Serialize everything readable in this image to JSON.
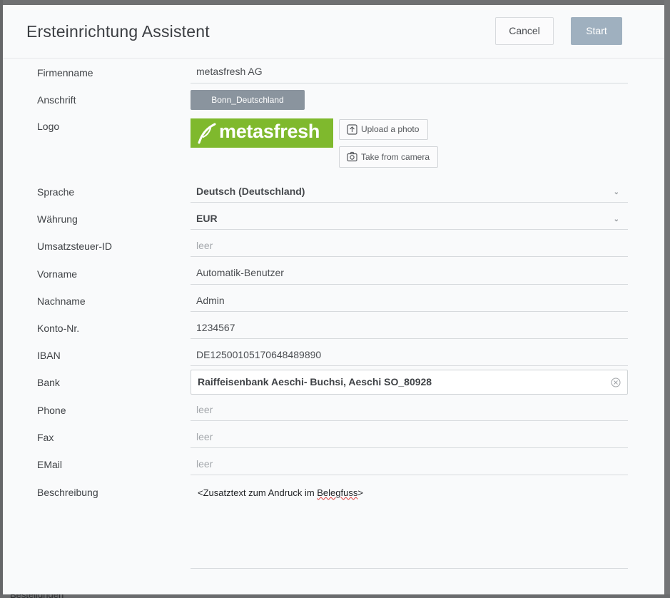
{
  "dialog": {
    "title": "Ersteinrichtung Assistent",
    "cancel_label": "Cancel",
    "start_label": "Start"
  },
  "fields": {
    "firmenname": {
      "label": "Firmenname",
      "value": "metasfresh AG"
    },
    "anschrift": {
      "label": "Anschrift",
      "value": "Bonn_Deutschland"
    },
    "logo": {
      "label": "Logo",
      "brand_text": "metasfresh",
      "brand_color": "#7fb92d",
      "upload_label": "Upload a photo",
      "camera_label": "Take from camera",
      "upload_icon": "upload-icon",
      "camera_icon": "camera-icon"
    },
    "sprache": {
      "label": "Sprache",
      "value": "Deutsch (Deutschland)"
    },
    "waehrung": {
      "label": "Währung",
      "value": "EUR"
    },
    "ust_id": {
      "label": "Umsatzsteuer-ID",
      "placeholder": "leer"
    },
    "vorname": {
      "label": "Vorname",
      "value": "Automatik-Benutzer"
    },
    "nachname": {
      "label": "Nachname",
      "value": "Admin"
    },
    "konto": {
      "label": "Konto-Nr.",
      "value": "1234567"
    },
    "iban": {
      "label": "IBAN",
      "value": "DE12500105170648489890"
    },
    "bank": {
      "label": "Bank",
      "value": "Raiffeisenbank Aeschi- Buchsi, Aeschi SO_80928"
    },
    "phone": {
      "label": "Phone",
      "placeholder": "leer"
    },
    "fax": {
      "label": "Fax",
      "placeholder": "leer"
    },
    "email": {
      "label": "EMail",
      "placeholder": "leer"
    },
    "beschreibung": {
      "label": "Beschreibung",
      "value_prefix": "<Zusatztext zum Andruck im ",
      "value_misspelled": "Belegfuss",
      "value_suffix": ">"
    }
  },
  "backdrop": {
    "partial_text": "Bestellungen"
  },
  "colors": {
    "start_button": "#9fb0bf",
    "address_button": "#8a949e"
  }
}
